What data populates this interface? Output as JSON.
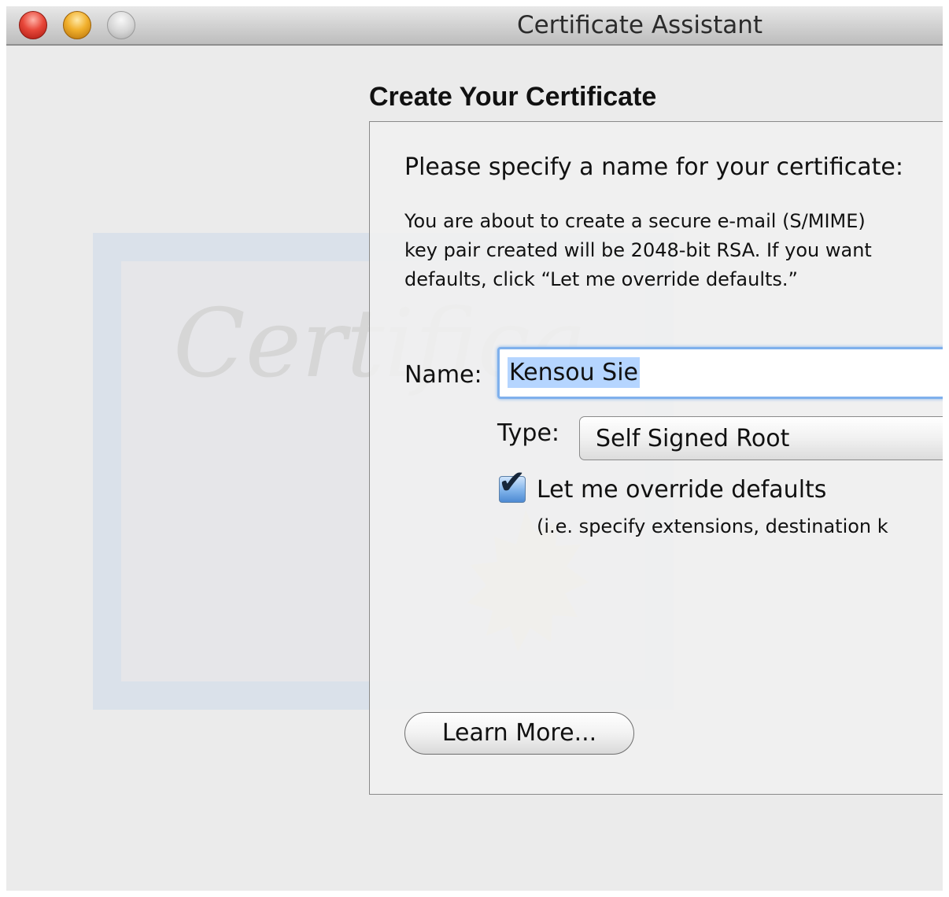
{
  "window": {
    "title": "Certificate Assistant",
    "controls": [
      "close",
      "minimize",
      "zoom"
    ]
  },
  "background_art": {
    "script_text": "Certifica",
    "seal_color": "#e8dcae"
  },
  "page": {
    "heading": "Create Your Certificate"
  },
  "panel": {
    "prompt": "Please specify a name for your certificate:",
    "description": "You are about to create a secure e-mail (S/MIME)\nkey pair created will be 2048-bit RSA. If you want\ndefaults, click “Let me override defaults.”",
    "name_label": "Name:",
    "name_value": "Kensou Sie",
    "type_label": "Type:",
    "type_value": "Self Signed Root",
    "override_label": "Let me override defaults",
    "override_checked": true,
    "override_hint": "(i.e. specify extensions, destination k",
    "learn_more_label": "Learn More..."
  },
  "colors": {
    "accent": "#7fb0ec",
    "selection": "#b5d5ff"
  }
}
